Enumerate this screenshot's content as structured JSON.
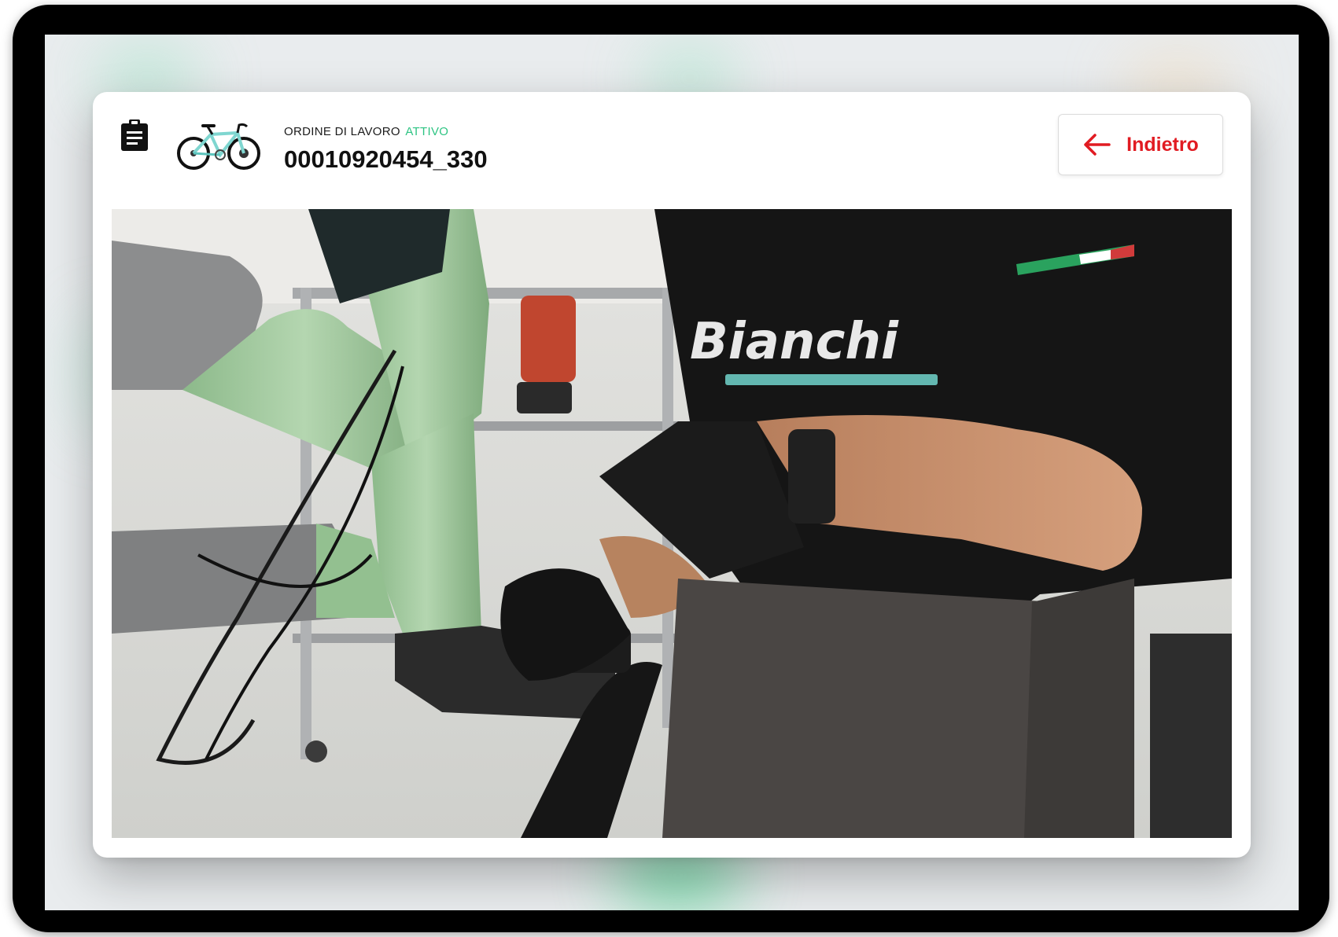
{
  "header": {
    "order_label": "ORDINE DI LAVORO",
    "order_status": "ATTIVO",
    "order_number": "00010920454_330",
    "back_label": "Indietro"
  },
  "icons": {
    "clipboard": "clipboard-icon",
    "bike": "bike-thumbnail",
    "back": "arrow-left-icon"
  },
  "video": {
    "shirt_brand": "Bianchi"
  },
  "colors": {
    "accent_red": "#e11b22",
    "status_green": "#2ec483",
    "frame_celeste": "#9cc79a"
  }
}
